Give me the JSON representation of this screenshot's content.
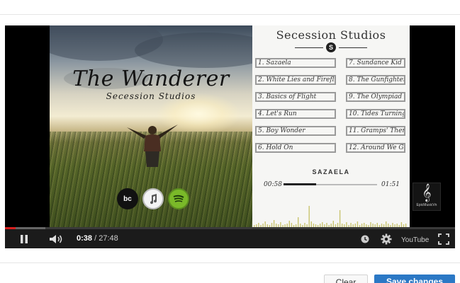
{
  "artwork": {
    "album_title": "The Wanderer",
    "album_subtitle": "Secession Studios"
  },
  "panel": {
    "studio_name": "Secession Studios",
    "studio_logo_letter": "S",
    "tracks_left": [
      "1. Sazaela",
      "2. White Lies and Fireflies",
      "3. Basics of Flight",
      "4. Let's Run",
      "5. Boy Wonder",
      "6. Hold On"
    ],
    "tracks_right": [
      "7. Sundance Kid",
      "8. The Gunfighter",
      "9. The Olympiad",
      "10. Tides Turning",
      "11. Gramps' Theme",
      "12. Around We Go"
    ],
    "now_playing_title": "SAZAELA",
    "now_playing_elapsed": "00:58",
    "now_playing_duration": "01:51",
    "now_playing_progress": 0.35
  },
  "badges": {
    "bandcamp_label": "bc"
  },
  "channel_logo": {
    "text": "EpicMusicVn"
  },
  "player": {
    "current_time": "0:38",
    "separator": " / ",
    "duration": "27:48",
    "played_fraction": 0.023,
    "loaded_fraction": 0.09,
    "youtube_label": "YouTube"
  },
  "footer": {
    "clear_label": "Clear",
    "primary_label": "Save changes"
  },
  "colors": {
    "progress_played": "#d8201f",
    "primary_button": "#2b78c5",
    "control_bar": "#1b1b1b"
  }
}
